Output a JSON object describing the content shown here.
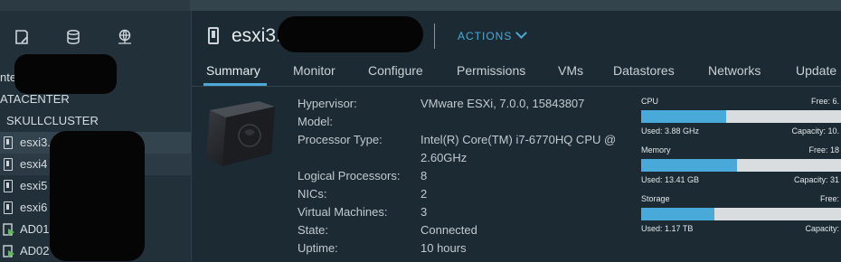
{
  "sidebar": {
    "tabs": [
      {
        "icon": "notes-icon"
      },
      {
        "icon": "database-icon"
      },
      {
        "icon": "network-globe-icon"
      }
    ],
    "items": [
      {
        "label": "nte",
        "type": "group"
      },
      {
        "label": "ATACENTER",
        "type": "datacenter"
      },
      {
        "label": "SKULLCLUSTER",
        "type": "cluster"
      },
      {
        "label": "esxi3.",
        "type": "host",
        "selected": true
      },
      {
        "label": "esxi4",
        "type": "host"
      },
      {
        "label": "esxi5",
        "type": "host"
      },
      {
        "label": "esxi6",
        "type": "host"
      },
      {
        "label": "AD01",
        "type": "vm"
      },
      {
        "label": "AD02",
        "type": "vm"
      }
    ]
  },
  "header": {
    "title": "esxi3.",
    "actions_label": "ACTIONS"
  },
  "tabs": [
    "Summary",
    "Monitor",
    "Configure",
    "Permissions",
    "VMs",
    "Datastores",
    "Networks",
    "Update"
  ],
  "active_tab": "Summary",
  "summary": [
    {
      "key": "Hypervisor:",
      "value": "VMware ESXi, 7.0.0, 15843807"
    },
    {
      "key": "Model:",
      "value": ""
    },
    {
      "key": "Processor Type:",
      "value": "Intel(R) Core(TM) i7-6770HQ CPU @"
    },
    {
      "key": "",
      "value": "2.60GHz"
    },
    {
      "key": "Logical Processors:",
      "value": "8"
    },
    {
      "key": "NICs:",
      "value": "2"
    },
    {
      "key": "Virtual Machines:",
      "value": "3"
    },
    {
      "key": "State:",
      "value": "Connected"
    },
    {
      "key": "Uptime:",
      "value": "10 hours"
    }
  ],
  "resources": [
    {
      "name": "CPU",
      "free": "Free: 6.",
      "used": "Used: 3.88 GHz",
      "capacity": "Capacity: 10.",
      "fraction": 0.41
    },
    {
      "name": "Memory",
      "free": "Free: 18",
      "used": "Used: 13.41 GB",
      "capacity": "Capacity: 31",
      "fraction": 0.46
    },
    {
      "name": "Storage",
      "free": "Free:",
      "used": "Used: 1.17 TB",
      "capacity": "Capacity:",
      "fraction": 0.35
    }
  ],
  "colors": {
    "accent": "#49aad9",
    "background": "#1b2a33",
    "sidebar": "#22303a"
  }
}
